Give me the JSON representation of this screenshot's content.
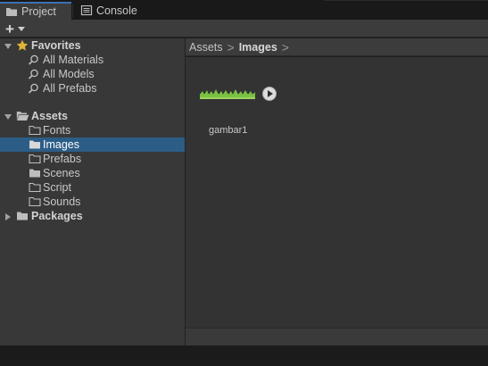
{
  "tabs": [
    {
      "label": "Project",
      "icon": "folder-icon",
      "active": true
    },
    {
      "label": "Console",
      "icon": "console-icon",
      "active": false
    }
  ],
  "toolbar": {
    "add_icon": "plus-icon",
    "dropdown_icon": "caret-down-icon"
  },
  "tree": {
    "favorites": {
      "label": "Favorites",
      "icon": "star-icon",
      "items": [
        {
          "label": "All Materials",
          "icon": "search-icon"
        },
        {
          "label": "All Models",
          "icon": "search-icon"
        },
        {
          "label": "All Prefabs",
          "icon": "search-icon"
        }
      ]
    },
    "assets": {
      "label": "Assets",
      "icon": "folder-open-icon",
      "items": [
        {
          "label": "Fonts",
          "icon": "folder-icon",
          "selected": false
        },
        {
          "label": "Images",
          "icon": "folder-icon",
          "selected": true
        },
        {
          "label": "Prefabs",
          "icon": "folder-icon",
          "selected": false
        },
        {
          "label": "Scenes",
          "icon": "folder-icon",
          "selected": false
        },
        {
          "label": "Script",
          "icon": "folder-icon",
          "selected": false
        },
        {
          "label": "Sounds",
          "icon": "folder-icon",
          "selected": false
        }
      ]
    },
    "packages": {
      "label": "Packages",
      "icon": "folder-icon"
    }
  },
  "breadcrumb": {
    "root": "Assets",
    "current": "Images",
    "separator": ">"
  },
  "asset": {
    "name": "gambar1",
    "thumbnail_icon": "grass-sprite-icon",
    "action_icon": "play-icon"
  },
  "colors": {
    "selection": "#2c5d87",
    "star": "#e2b53a",
    "grass": "#7ac142"
  }
}
